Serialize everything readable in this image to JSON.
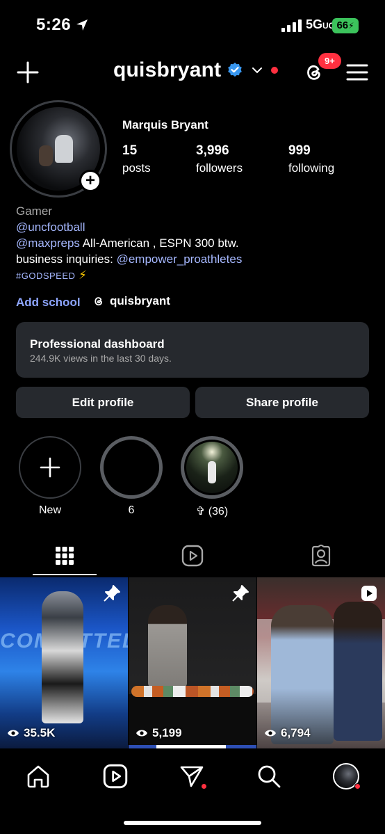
{
  "status_bar": {
    "time": "5:26",
    "network": "5G",
    "network_suffix": "UC",
    "battery": "66"
  },
  "header": {
    "username": "quisbryant",
    "notifications_badge": "9+"
  },
  "profile": {
    "full_name": "Marquis Bryant",
    "stats": [
      {
        "value": "15",
        "label": "posts"
      },
      {
        "value": "3,996",
        "label": "followers"
      },
      {
        "value": "999",
        "label": "following"
      }
    ],
    "bio": {
      "category": "Gamer",
      "link1": "@uncfootball",
      "line2_mention": "@maxpreps",
      "line2_text": " All-American , ESPN 300 btw.",
      "line3_text": "business inquiries: ",
      "line3_mention": "@empower_proathletes",
      "hashtag": "#GODSPEED",
      "hashtag_emoji": "⚡"
    },
    "add_school": "Add school",
    "threads_handle": "quisbryant"
  },
  "dashboard": {
    "title": "Professional dashboard",
    "subtitle": "244.9K views in the last 30 days."
  },
  "buttons": {
    "edit": "Edit profile",
    "share": "Share profile"
  },
  "highlights": [
    {
      "label": "New"
    },
    {
      "label": "6"
    },
    {
      "label": "✞ (36)"
    }
  ],
  "posts": [
    {
      "views": "35.5K",
      "pinned": true,
      "overlay_text": "COMMITTED"
    },
    {
      "views": "5,199",
      "pinned": true
    },
    {
      "views": "6,794",
      "type": "reel"
    }
  ],
  "colors": {
    "accent_link": "#a6b8ff",
    "badge_red": "#ff3040",
    "verified_blue": "#3897f0",
    "battery_green": "#3cc35c"
  }
}
